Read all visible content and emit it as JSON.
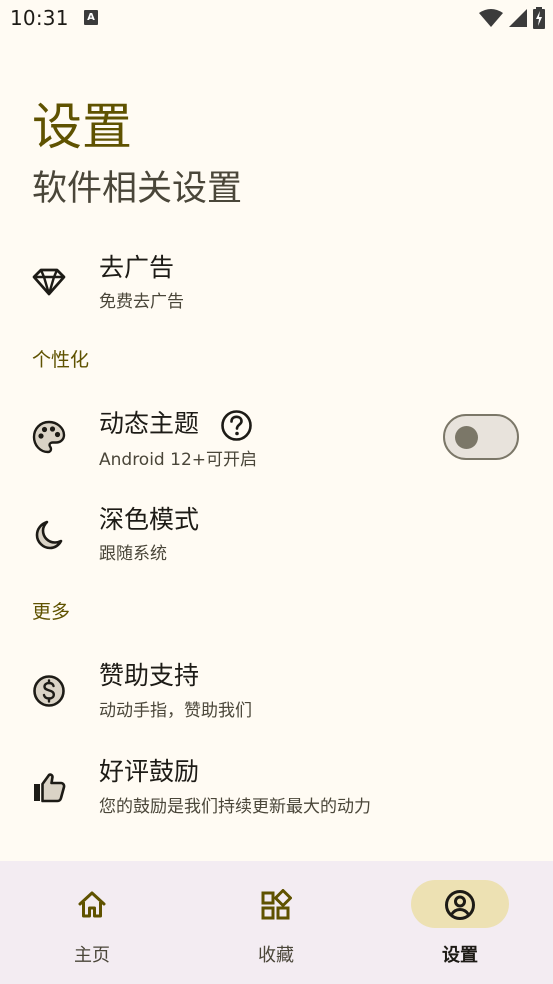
{
  "status_bar": {
    "time": "10:31",
    "notification_letter": "A"
  },
  "header": {
    "title": "设置",
    "subtitle": "软件相关设置"
  },
  "settings": {
    "remove_ads": {
      "title": "去广告",
      "description": "免费去广告",
      "icon": "diamond-icon"
    },
    "personalization_header": "个性化",
    "dynamic_theme": {
      "title": "动态主题",
      "description": "Android 12+可开启",
      "icon": "palette-icon",
      "enabled": false
    },
    "dark_mode": {
      "title": "深色模式",
      "description": "跟随系统",
      "icon": "moon-icon"
    },
    "more_header": "更多",
    "sponsor": {
      "title": "赞助支持",
      "description": "动动手指，赞助我们",
      "icon": "dollar-icon"
    },
    "rate": {
      "title": "好评鼓励",
      "description": "您的鼓励是我们持续更新最大的动力",
      "icon": "thumb-up-icon"
    }
  },
  "bottom_nav": {
    "items": [
      {
        "label": "主页",
        "icon": "home-icon",
        "active": false
      },
      {
        "label": "收藏",
        "icon": "widgets-icon",
        "active": false
      },
      {
        "label": "设置",
        "icon": "account-icon",
        "active": true
      }
    ]
  },
  "colors": {
    "background": "#FFFBF3",
    "primary": "#5F5200",
    "nav_background": "#F3ECF2",
    "active_pill": "#EDE1B3"
  }
}
